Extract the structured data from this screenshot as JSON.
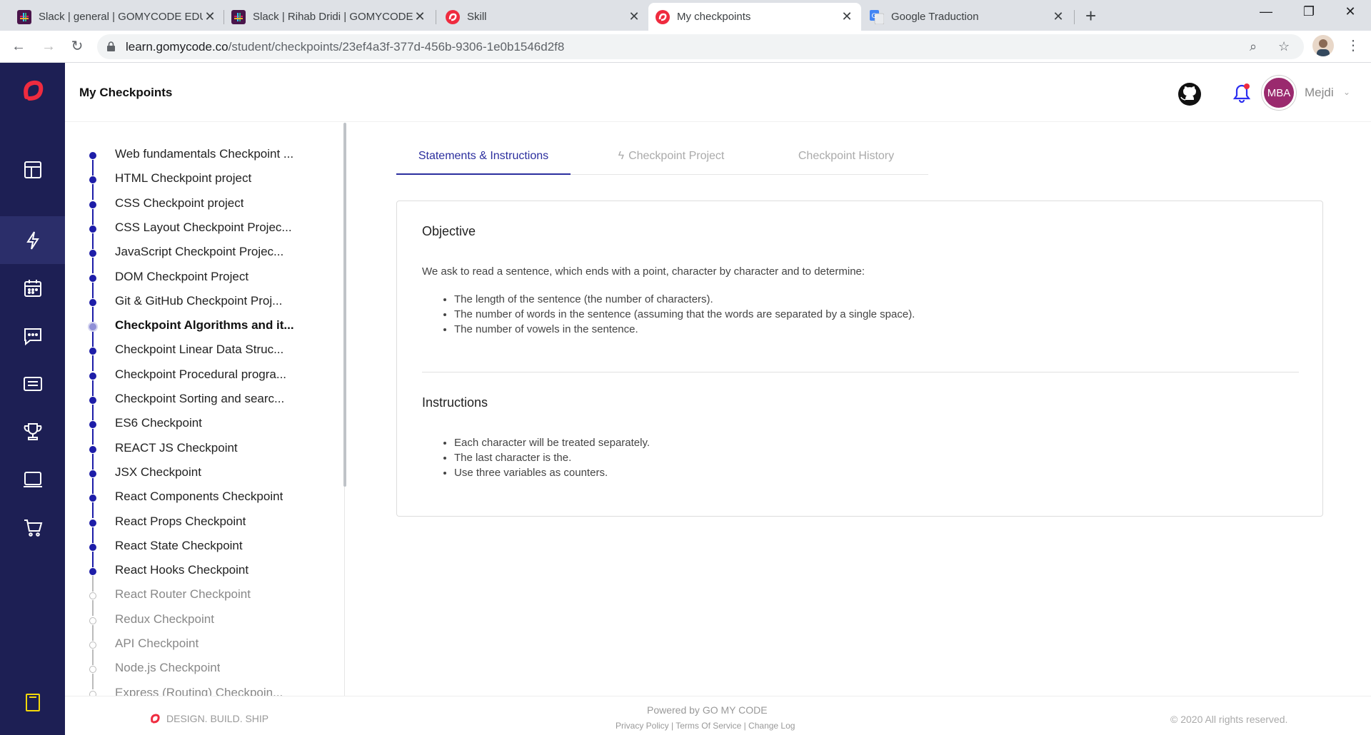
{
  "browser": {
    "tabs": [
      {
        "title": "Slack | general | GOMYCODE EDU",
        "icon": "slack-icon",
        "active": false
      },
      {
        "title": "Slack | Rihab Dridi | GOMYCODE E",
        "icon": "slack-icon",
        "active": false
      },
      {
        "title": "Skill",
        "icon": "gomycode-icon",
        "active": false
      },
      {
        "title": "My checkpoints",
        "icon": "gomycode-icon",
        "active": true
      },
      {
        "title": "Google Traduction",
        "icon": "google-translate-icon",
        "active": false
      }
    ],
    "url_host": "learn.gomycode.co",
    "url_path": "/student/checkpoints/23ef4a3f-377d-456b-9306-1e0b1546d2f8"
  },
  "header": {
    "title": "My Checkpoints",
    "avatar_initials": "MBA",
    "username": "Mejdi"
  },
  "colors": {
    "brand_red": "#ef2b3f",
    "rail": "#1d1f54",
    "accent": "#2b2e9e",
    "done_dot": "#1d1da8"
  },
  "checkpoints": [
    {
      "label": "Web fundamentals Checkpoint ...",
      "state": "done"
    },
    {
      "label": "HTML Checkpoint project",
      "state": "done"
    },
    {
      "label": "CSS Checkpoint project",
      "state": "done"
    },
    {
      "label": "CSS Layout Checkpoint Projec...",
      "state": "done"
    },
    {
      "label": "JavaScript Checkpoint Projec...",
      "state": "done"
    },
    {
      "label": "DOM Checkpoint Project",
      "state": "done"
    },
    {
      "label": "Git & GitHub Checkpoint Proj...",
      "state": "done"
    },
    {
      "label": "Checkpoint Algorithms and it...",
      "state": "current"
    },
    {
      "label": "Checkpoint Linear Data Struc...",
      "state": "done"
    },
    {
      "label": "Checkpoint Procedural progra...",
      "state": "done"
    },
    {
      "label": "Checkpoint Sorting and searc...",
      "state": "done"
    },
    {
      "label": "ES6 Checkpoint",
      "state": "done"
    },
    {
      "label": "REACT JS Checkpoint",
      "state": "done"
    },
    {
      "label": "JSX Checkpoint",
      "state": "done"
    },
    {
      "label": "React Components Checkpoint",
      "state": "done"
    },
    {
      "label": "React Props Checkpoint",
      "state": "done"
    },
    {
      "label": "React State Checkpoint",
      "state": "done"
    },
    {
      "label": "React Hooks Checkpoint",
      "state": "done"
    },
    {
      "label": "React Router Checkpoint",
      "state": "todo"
    },
    {
      "label": "Redux Checkpoint",
      "state": "todo"
    },
    {
      "label": "API Checkpoint",
      "state": "todo"
    },
    {
      "label": "Node.js Checkpoint",
      "state": "todo"
    },
    {
      "label": "Express (Routing) Checkpoin...",
      "state": "todo"
    }
  ],
  "tabs": {
    "statements": "Statements & Instructions",
    "project": "Checkpoint Project",
    "history": "Checkpoint History"
  },
  "content": {
    "objective_title": "Objective",
    "objective_text": "We ask to read a sentence, which ends with a point, character by character and to determine:",
    "objective_items": [
      "The length of the sentence (the number of characters).",
      "The number of words in the sentence (assuming that the words are separated by a single space).",
      "The number of vowels in the sentence."
    ],
    "instructions_title": "Instructions",
    "instructions_items": [
      "Each character will be treated separately.",
      "The last character is the.",
      "Use three variables as counters."
    ]
  },
  "footer": {
    "brand": "DESIGN. BUILD. SHIP",
    "powered": "Powered by GO MY CODE",
    "links": "Privacy Policy | Terms Of Service | Change Log",
    "copyright": "© 2020 All rights reserved."
  }
}
